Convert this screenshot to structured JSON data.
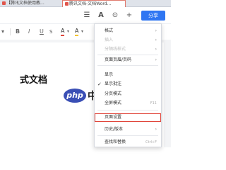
{
  "tabs": [
    {
      "label": "【腾讯文档使用教..."
    },
    {
      "label": "腾讯文档-文档Word..."
    }
  ],
  "appbar": {
    "menu_icon": "hamburger-icon",
    "font_icon": "text-style-icon",
    "share_label": "分享"
  },
  "toolbar": {
    "bold": "B",
    "italic": "I",
    "underline": "U",
    "font_color": "A",
    "highlight": "A"
  },
  "document": {
    "title": "式文档"
  },
  "watermark": {
    "badge": "php",
    "text": "中文网"
  },
  "menu": {
    "items": [
      {
        "label": "格式"
      },
      {
        "label": "插入"
      },
      {
        "label": "分隔线样式"
      },
      {
        "label": "页面页眉/页码"
      },
      {
        "label": "显示"
      },
      {
        "label": "显示批注"
      },
      {
        "label": "分页模式"
      },
      {
        "label": "全屏模式",
        "shortcut": "F11"
      },
      {
        "label": "页面设置"
      },
      {
        "label": "历史/版本"
      },
      {
        "label": "查找和替换",
        "shortcut": "Ctrl+F"
      }
    ]
  },
  "colors": {
    "accent": "#2f76f2",
    "highlight_outline": "#e0453a"
  }
}
